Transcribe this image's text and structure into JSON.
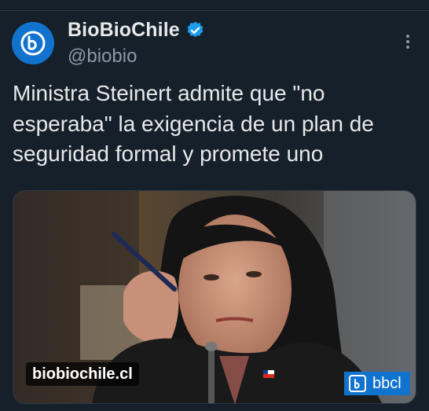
{
  "post": {
    "author": {
      "display_name": "BioBioChile",
      "handle": "@biobio",
      "verified": true,
      "avatar_icon": "biobio-logo-icon",
      "avatar_color": "#1173cd"
    },
    "text": "Ministra Steinert admite que \"no esperaba\" la exigencia de un plan de seguridad formal y promete uno",
    "media": {
      "image_description_icon": "photo",
      "source_label": "biobiochile.cl",
      "watermark_label": "bbcl"
    }
  },
  "theme": {
    "background": "#15202b",
    "text": "#e7e9ea",
    "muted": "#8b98a5",
    "verified_badge": "#1d9bf0"
  },
  "icons": {
    "more": "more-options-icon",
    "verified": "verified-badge-icon"
  }
}
